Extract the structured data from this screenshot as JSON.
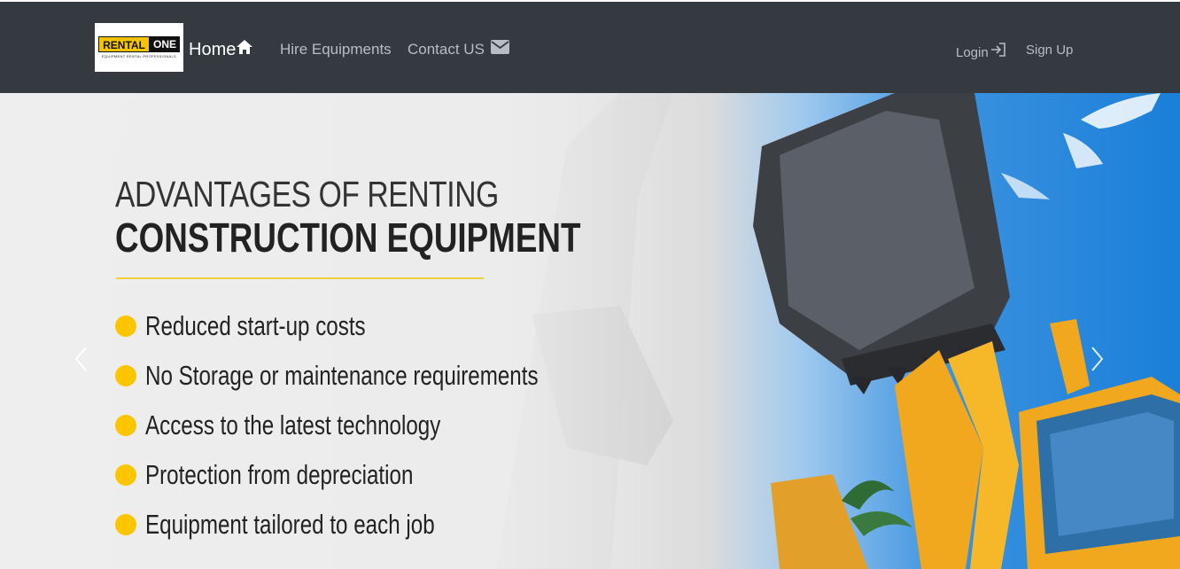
{
  "brand": {
    "logo_rental": "RENTAL",
    "logo_one": "ONE",
    "logo_tagline": "EQUIPMENT RENTAL PROFESSIONALS"
  },
  "nav": {
    "home": "Home",
    "hire": "Hire Equipments",
    "contact": "Contact US",
    "login": "Login",
    "signup": "Sign Up"
  },
  "hero": {
    "headline_light": "ADVANTAGES OF RENTING",
    "headline_bold": "CONSTRUCTION EQUIPMENT",
    "bullets": [
      "Reduced start-up costs",
      "No Storage or maintenance requirements",
      "Access to the latest technology",
      "Protection from depreciation",
      "Equipment tailored to each job"
    ]
  },
  "icons": {
    "home": "home-icon",
    "contact": "envelope-icon",
    "login": "login-icon",
    "prev": "chevron-left-icon",
    "next": "chevron-right-icon"
  },
  "colors": {
    "navbar": "#343a40",
    "accent_yellow": "#fdc400",
    "nav_link": "#b9bdc1"
  }
}
